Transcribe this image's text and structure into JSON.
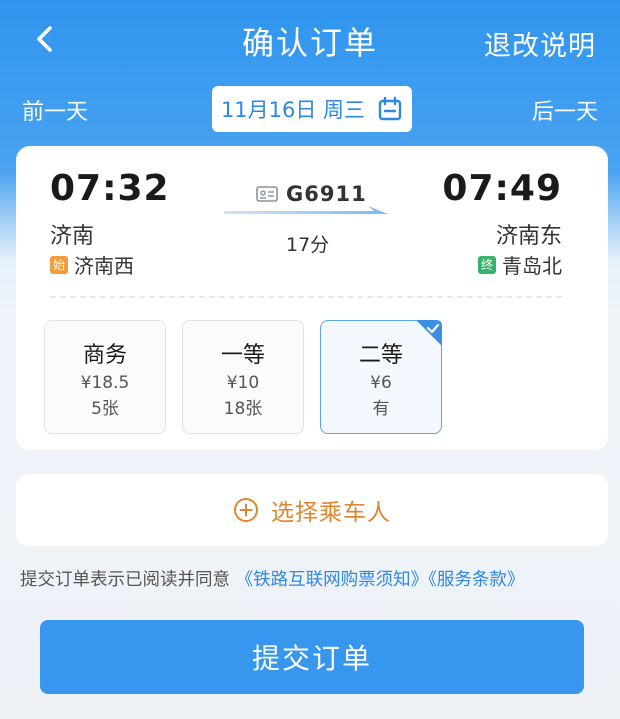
{
  "header": {
    "title": "确认订单",
    "refund_link": "退改说明",
    "back_icon": "chevron-left-icon"
  },
  "date_nav": {
    "prev_label": "前一天",
    "date_label": "11月16日 周三",
    "next_label": "后一天",
    "calendar_icon": "calendar-icon"
  },
  "train": {
    "departure_time": "07:32",
    "departure_city": "济南",
    "departure_station": "济南西",
    "departure_badge": "始",
    "train_number": "G6911",
    "duration": "17分",
    "arrival_time": "07:49",
    "arrival_city": "济南东",
    "arrival_station": "青岛北",
    "arrival_badge": "终"
  },
  "seats": [
    {
      "name": "商务",
      "price": "¥18.5",
      "availability": "5张",
      "selected": false
    },
    {
      "name": "一等",
      "price": "¥10",
      "availability": "18张",
      "selected": false
    },
    {
      "name": "二等",
      "price": "¥6",
      "availability": "有",
      "selected": true
    }
  ],
  "passenger": {
    "add_label": "选择乘车人"
  },
  "agreement": {
    "prefix": "提交订单表示已阅读并同意",
    "link1": "《铁路互联网购票须知》",
    "link2": "《服务条款》"
  },
  "submit": {
    "label": "提交订单"
  },
  "colors": {
    "primary": "#3797ee",
    "link": "#2f87e6",
    "accent_orange": "#e0862e",
    "badge_start": "#f39a3d",
    "badge_end": "#39b36b"
  }
}
